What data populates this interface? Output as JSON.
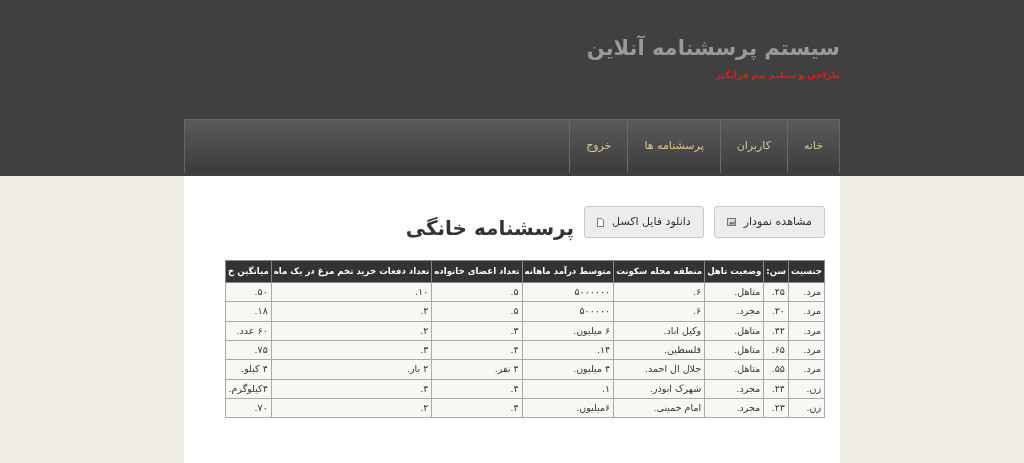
{
  "site": {
    "title": "سیستم پرسشنامه آنلاین",
    "credit": "طراحی و تنظیم تیم فرابگیر"
  },
  "nav": [
    {
      "label": "خانه",
      "selected": false
    },
    {
      "label": "کاربران",
      "selected": false
    },
    {
      "label": "پرسشنامه ها",
      "selected": false
    },
    {
      "label": "خروج",
      "selected": false
    }
  ],
  "page": {
    "title": "پرسشنامه خانگی",
    "buttons": [
      {
        "label": "مشاهده نمودار",
        "kind": "chart"
      },
      {
        "label": "دانلود فایل اکسل",
        "kind": "file"
      }
    ]
  },
  "table": {
    "columns": [
      "جنسیت",
      "سن:",
      "وضعیت تاهل",
      "منطقه محله سکونت",
      "متوسط درآمد ماهانه",
      "تعداد اعضای خانواده",
      "تعداد دفعات خرید تخم مرغ در یک ماه",
      "میانگین خ"
    ],
    "rows": [
      [
        "مرد.",
        "۲۵.",
        "متاهل.",
        "۶.",
        "۵۰۰۰۰۰۰",
        "۵.",
        "۱۰.",
        "۵۰."
      ],
      [
        "مرد.",
        "۲۰.",
        "مجرد.",
        "۶.",
        "۵۰۰۰۰۰",
        "۵.",
        "۲.",
        "۱۸."
      ],
      [
        "مرد.",
        "۴۲.",
        "متاهل.",
        "وکیل اباد.",
        "۶ میلیون.",
        "۳.",
        "۲.",
        "۶۰ عدد."
      ],
      [
        "مرد.",
        "۶۵.",
        "متاهل.",
        "فلسطین.",
        "۱۴.",
        "۴.",
        "۳.",
        "۷۵."
      ],
      [
        "مرد.",
        "۵۵.",
        "متاهل.",
        "جلال ال احمد.",
        "۴ میلیون.",
        "۴ نفر.",
        "۲ بار.",
        "۴ کیلو."
      ],
      [
        "زن.",
        "۲۴.",
        "مجرد.",
        "شهرک ابوذر.",
        "۱.",
        "۴.",
        "۴.",
        "۴کیلوگرم."
      ],
      [
        "زن.",
        "۲۳.",
        "مجرد.",
        "امام خمینی.",
        "۶میلیون.",
        "۴.",
        "۲.",
        "۷۰."
      ]
    ]
  }
}
